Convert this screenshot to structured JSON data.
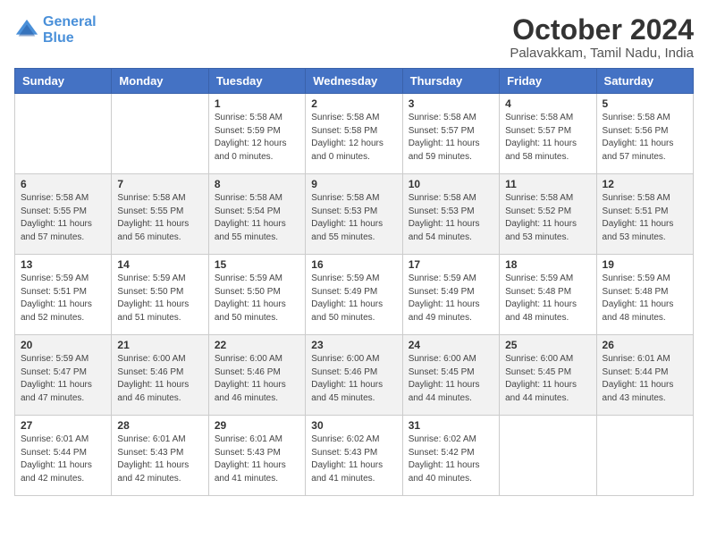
{
  "header": {
    "logo_line1": "General",
    "logo_line2": "Blue",
    "month_title": "October 2024",
    "subtitle": "Palavakkam, Tamil Nadu, India"
  },
  "weekdays": [
    "Sunday",
    "Monday",
    "Tuesday",
    "Wednesday",
    "Thursday",
    "Friday",
    "Saturday"
  ],
  "weeks": [
    [
      {
        "day": "",
        "info": ""
      },
      {
        "day": "",
        "info": ""
      },
      {
        "day": "1",
        "info": "Sunrise: 5:58 AM\nSunset: 5:59 PM\nDaylight: 12 hours\nand 0 minutes."
      },
      {
        "day": "2",
        "info": "Sunrise: 5:58 AM\nSunset: 5:58 PM\nDaylight: 12 hours\nand 0 minutes."
      },
      {
        "day": "3",
        "info": "Sunrise: 5:58 AM\nSunset: 5:57 PM\nDaylight: 11 hours\nand 59 minutes."
      },
      {
        "day": "4",
        "info": "Sunrise: 5:58 AM\nSunset: 5:57 PM\nDaylight: 11 hours\nand 58 minutes."
      },
      {
        "day": "5",
        "info": "Sunrise: 5:58 AM\nSunset: 5:56 PM\nDaylight: 11 hours\nand 57 minutes."
      }
    ],
    [
      {
        "day": "6",
        "info": "Sunrise: 5:58 AM\nSunset: 5:55 PM\nDaylight: 11 hours\nand 57 minutes."
      },
      {
        "day": "7",
        "info": "Sunrise: 5:58 AM\nSunset: 5:55 PM\nDaylight: 11 hours\nand 56 minutes."
      },
      {
        "day": "8",
        "info": "Sunrise: 5:58 AM\nSunset: 5:54 PM\nDaylight: 11 hours\nand 55 minutes."
      },
      {
        "day": "9",
        "info": "Sunrise: 5:58 AM\nSunset: 5:53 PM\nDaylight: 11 hours\nand 55 minutes."
      },
      {
        "day": "10",
        "info": "Sunrise: 5:58 AM\nSunset: 5:53 PM\nDaylight: 11 hours\nand 54 minutes."
      },
      {
        "day": "11",
        "info": "Sunrise: 5:58 AM\nSunset: 5:52 PM\nDaylight: 11 hours\nand 53 minutes."
      },
      {
        "day": "12",
        "info": "Sunrise: 5:58 AM\nSunset: 5:51 PM\nDaylight: 11 hours\nand 53 minutes."
      }
    ],
    [
      {
        "day": "13",
        "info": "Sunrise: 5:59 AM\nSunset: 5:51 PM\nDaylight: 11 hours\nand 52 minutes."
      },
      {
        "day": "14",
        "info": "Sunrise: 5:59 AM\nSunset: 5:50 PM\nDaylight: 11 hours\nand 51 minutes."
      },
      {
        "day": "15",
        "info": "Sunrise: 5:59 AM\nSunset: 5:50 PM\nDaylight: 11 hours\nand 50 minutes."
      },
      {
        "day": "16",
        "info": "Sunrise: 5:59 AM\nSunset: 5:49 PM\nDaylight: 11 hours\nand 50 minutes."
      },
      {
        "day": "17",
        "info": "Sunrise: 5:59 AM\nSunset: 5:49 PM\nDaylight: 11 hours\nand 49 minutes."
      },
      {
        "day": "18",
        "info": "Sunrise: 5:59 AM\nSunset: 5:48 PM\nDaylight: 11 hours\nand 48 minutes."
      },
      {
        "day": "19",
        "info": "Sunrise: 5:59 AM\nSunset: 5:48 PM\nDaylight: 11 hours\nand 48 minutes."
      }
    ],
    [
      {
        "day": "20",
        "info": "Sunrise: 5:59 AM\nSunset: 5:47 PM\nDaylight: 11 hours\nand 47 minutes."
      },
      {
        "day": "21",
        "info": "Sunrise: 6:00 AM\nSunset: 5:46 PM\nDaylight: 11 hours\nand 46 minutes."
      },
      {
        "day": "22",
        "info": "Sunrise: 6:00 AM\nSunset: 5:46 PM\nDaylight: 11 hours\nand 46 minutes."
      },
      {
        "day": "23",
        "info": "Sunrise: 6:00 AM\nSunset: 5:46 PM\nDaylight: 11 hours\nand 45 minutes."
      },
      {
        "day": "24",
        "info": "Sunrise: 6:00 AM\nSunset: 5:45 PM\nDaylight: 11 hours\nand 44 minutes."
      },
      {
        "day": "25",
        "info": "Sunrise: 6:00 AM\nSunset: 5:45 PM\nDaylight: 11 hours\nand 44 minutes."
      },
      {
        "day": "26",
        "info": "Sunrise: 6:01 AM\nSunset: 5:44 PM\nDaylight: 11 hours\nand 43 minutes."
      }
    ],
    [
      {
        "day": "27",
        "info": "Sunrise: 6:01 AM\nSunset: 5:44 PM\nDaylight: 11 hours\nand 42 minutes."
      },
      {
        "day": "28",
        "info": "Sunrise: 6:01 AM\nSunset: 5:43 PM\nDaylight: 11 hours\nand 42 minutes."
      },
      {
        "day": "29",
        "info": "Sunrise: 6:01 AM\nSunset: 5:43 PM\nDaylight: 11 hours\nand 41 minutes."
      },
      {
        "day": "30",
        "info": "Sunrise: 6:02 AM\nSunset: 5:43 PM\nDaylight: 11 hours\nand 41 minutes."
      },
      {
        "day": "31",
        "info": "Sunrise: 6:02 AM\nSunset: 5:42 PM\nDaylight: 11 hours\nand 40 minutes."
      },
      {
        "day": "",
        "info": ""
      },
      {
        "day": "",
        "info": ""
      }
    ]
  ]
}
